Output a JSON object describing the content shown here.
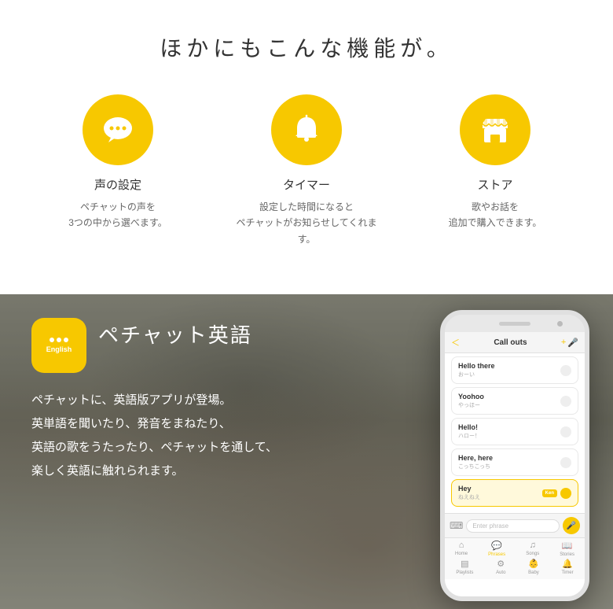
{
  "top": {
    "main_title": "ほかにもこんな機能が。",
    "features": [
      {
        "id": "voice",
        "title": "声の設定",
        "desc": "ペチャットの声を\n3つの中から選べます。",
        "icon": "chat"
      },
      {
        "id": "timer",
        "title": "タイマー",
        "desc": "設定した時間になると\nペチャットがお知らせしてくれます。",
        "icon": "bell"
      },
      {
        "id": "store",
        "title": "ストア",
        "desc": "歌やお話を\n追加で購入できます。",
        "icon": "store"
      }
    ]
  },
  "bottom": {
    "badge_text": "English",
    "section_title": "ペチャット英語",
    "body_lines": [
      "ペチャットに、英語版アプリが登場。",
      "英単語を聞いたり、発音をまねたり、",
      "英語の歌をうたったり、ペチャットを通して、",
      "楽しく英語に触れられます。"
    ],
    "phone": {
      "header": {
        "back": "＜",
        "title": "Call outs",
        "add": "+"
      },
      "callouts": [
        {
          "title": "Hello there",
          "sub": "おーい",
          "active": false
        },
        {
          "title": "Yoohoo",
          "sub": "やっほー",
          "active": false
        },
        {
          "title": "Hello!",
          "sub": "ハロー！",
          "active": false
        },
        {
          "title": "Here, here",
          "sub": "こっちこっち",
          "active": false
        },
        {
          "title": "Hey",
          "sub": "ねえねえ",
          "active": true,
          "badge": "Ken"
        }
      ],
      "input_placeholder": "Enter phrase",
      "nav": {
        "row1": [
          {
            "label": "Home",
            "icon": "⌂",
            "active": false
          },
          {
            "label": "Phrases",
            "icon": "💬",
            "active": true
          },
          {
            "label": "Songs",
            "icon": "♫",
            "active": false
          },
          {
            "label": "Stories",
            "icon": "📖",
            "active": false
          }
        ],
        "row2": [
          {
            "label": "Playlists",
            "icon": "▤",
            "active": false
          },
          {
            "label": "Auto",
            "icon": "⚙",
            "active": false
          },
          {
            "label": "Baby",
            "icon": "👶",
            "active": false
          },
          {
            "label": "Timer",
            "icon": "🔔",
            "active": false
          }
        ]
      }
    }
  },
  "colors": {
    "yellow": "#f7c800",
    "dark_bg": "#6b6b6b",
    "white": "#ffffff"
  }
}
